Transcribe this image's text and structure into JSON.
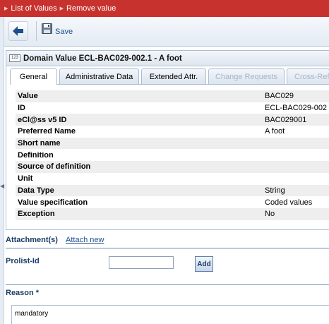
{
  "breadcrumbs": [
    "List of Values",
    "Remove value"
  ],
  "toolbar": {
    "back_icon": "arrow-left-icon",
    "save_icon": "floppy-disk-icon",
    "save_label": "Save"
  },
  "panel": {
    "badge": "123",
    "title": "Domain Value ECL-BAC029-002.1 - A foot",
    "tabs": [
      {
        "label": "General",
        "state": "active"
      },
      {
        "label": "Administrative Data",
        "state": "normal"
      },
      {
        "label": "Extended Attr.",
        "state": "normal"
      },
      {
        "label": "Change Requests",
        "state": "disabled"
      },
      {
        "label": "Cross-Refe",
        "state": "disabled"
      }
    ],
    "fields": [
      {
        "label": "Value",
        "value": "BAC029"
      },
      {
        "label": "ID",
        "value": "ECL-BAC029-002"
      },
      {
        "label": "eCl@ss v5 ID",
        "value": "BAC029001"
      },
      {
        "label": "Preferred Name",
        "value": "A foot"
      },
      {
        "label": "Short name",
        "value": ""
      },
      {
        "label": "Definition",
        "value": ""
      },
      {
        "label": "Source of definition",
        "value": ""
      },
      {
        "label": "Unit",
        "value": ""
      },
      {
        "label": "Data Type",
        "value": "String"
      },
      {
        "label": "Value specification",
        "value": "Coded values"
      },
      {
        "label": "Exception",
        "value": "No"
      }
    ]
  },
  "attachments": {
    "label": "Attachment(s)",
    "link": "Attach new"
  },
  "prolist": {
    "label": "Prolist-Id",
    "value": "",
    "button": "Add"
  },
  "reason": {
    "label": "Reason *",
    "value": "mandatory"
  },
  "colors": {
    "topbar": "#c8322e",
    "link": "#1e4f8c",
    "border": "#a9bdd3"
  }
}
